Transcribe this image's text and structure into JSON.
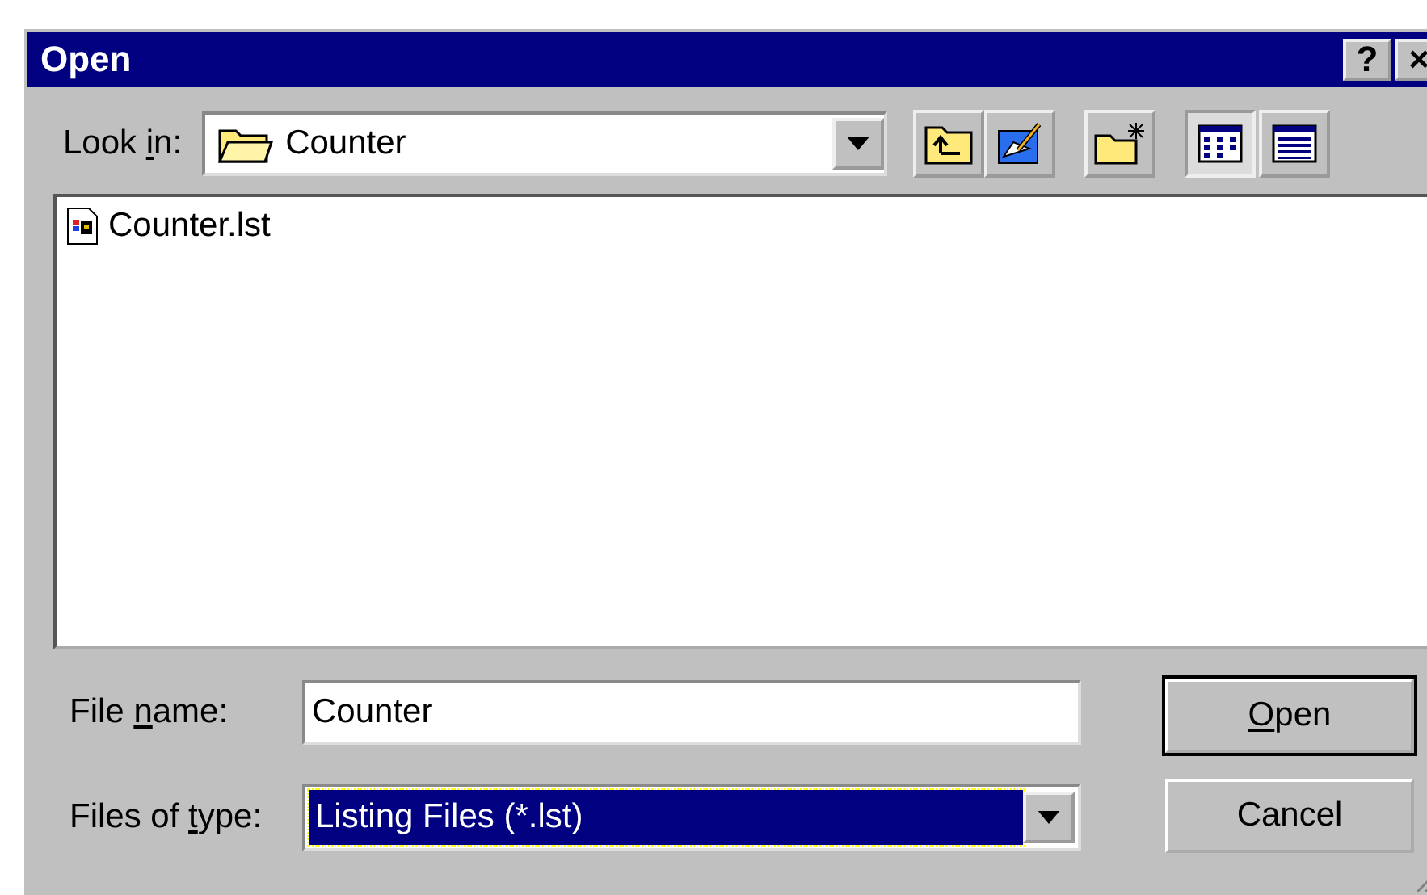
{
  "window": {
    "title": "Open",
    "title_buttons": [
      "?",
      "×"
    ]
  },
  "look_in": {
    "label": {
      "before": "Look ",
      "key": "i",
      "after": "n:"
    },
    "value": "Counter"
  },
  "toolbar": [
    {
      "kind": "up",
      "selected": false
    },
    {
      "kind": "desktop",
      "selected": false
    },
    {
      "kind": "newfolder",
      "selected": false
    },
    {
      "kind": "list",
      "selected": true
    },
    {
      "kind": "details",
      "selected": false
    }
  ],
  "files": [
    {
      "name": "Counter.lst",
      "selected": false
    }
  ],
  "file_name": {
    "label": {
      "before": "File ",
      "key": "n",
      "after": "ame:"
    },
    "value": "Counter"
  },
  "file_type": {
    "label": {
      "before": "Files of ",
      "key": "t",
      "after": "ype:"
    },
    "value": "Listing Files (*.lst)"
  },
  "buttons": [
    {
      "label": {
        "key": "O",
        "after": "pen"
      },
      "default": true
    },
    {
      "label": {
        "before": "Cancel"
      },
      "default": false
    }
  ]
}
